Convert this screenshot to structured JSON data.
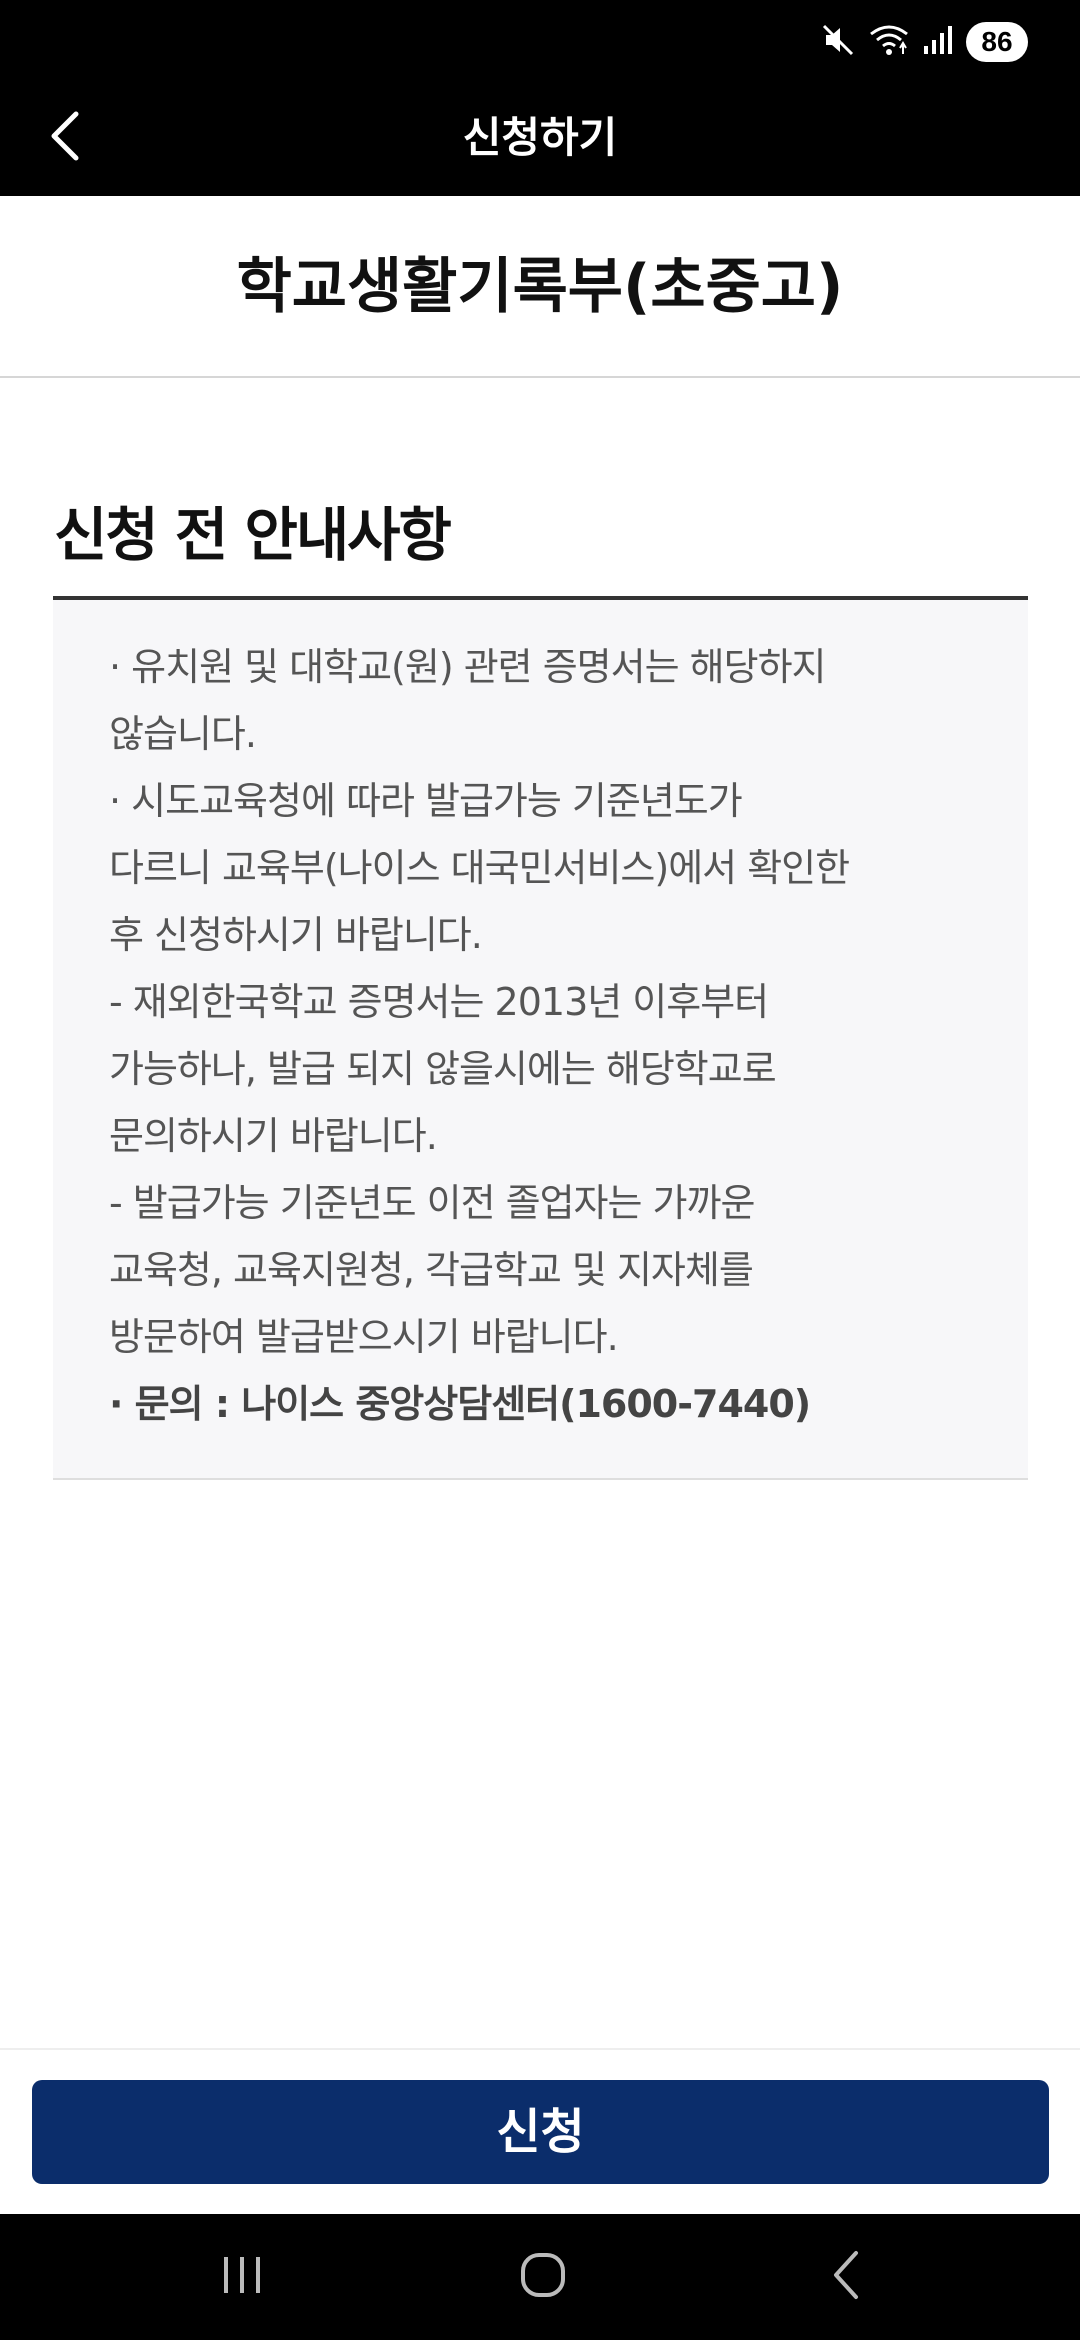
{
  "status_bar": {
    "battery": "86",
    "icons": [
      "mute-icon",
      "wifi-icon",
      "signal-icon"
    ]
  },
  "header": {
    "title": "신청하기",
    "back_icon": "chevron-left-icon"
  },
  "document": {
    "title": "학교생활기록부(초중고)"
  },
  "notice": {
    "heading": "신청 전 안내사항",
    "lines": [
      " · 유치원 및 대학교(원) 관련 증명서는 해당하지",
      "않습니다.",
      " · 시도교육청에 따라 발급가능 기준년도가",
      "다르니 교육부(나이스 대국민서비스)에서 확인한",
      "후 신청하시기 바랍니다.",
      "- 재외한국학교 증명서는 2013년 이후부터",
      "가능하나, 발급 되지 않을시에는 해당학교로",
      "문의하시기 바랍니다.",
      "- 발급가능 기준년도 이전 졸업자는 가까운",
      "교육청, 교육지원청, 각급학교 및 지자체를",
      "방문하여 발급받으시기 바랍니다."
    ],
    "contact_line": " · 문의 : 나이스 중앙상담센터(1600-7440)"
  },
  "actions": {
    "apply_label": "신청"
  },
  "colors": {
    "header_bg": "#000000",
    "button_bg": "#0b2d6b",
    "notice_bg": "#f7f7f9"
  },
  "nav": {
    "items": [
      "recent-apps-icon",
      "home-icon",
      "back-icon"
    ]
  }
}
